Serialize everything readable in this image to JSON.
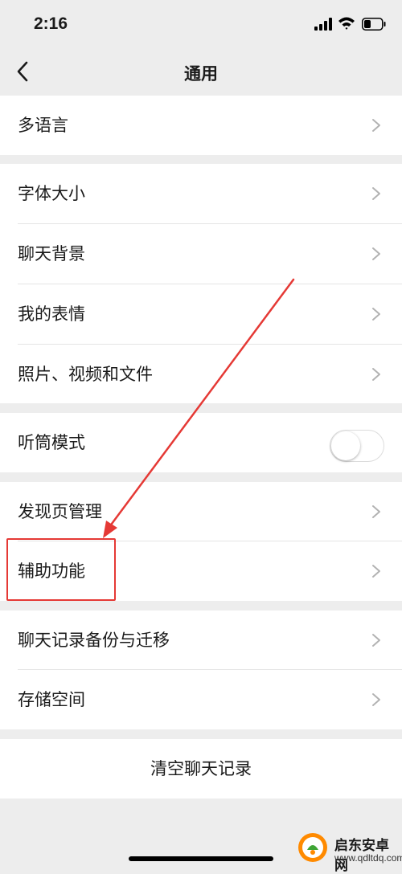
{
  "status_bar": {
    "time": "2:16"
  },
  "nav": {
    "title": "通用"
  },
  "groups": [
    {
      "items": [
        {
          "label": "多语言",
          "type": "chevron"
        }
      ]
    },
    {
      "items": [
        {
          "label": "字体大小",
          "type": "chevron"
        },
        {
          "label": "聊天背景",
          "type": "chevron"
        },
        {
          "label": "我的表情",
          "type": "chevron"
        },
        {
          "label": "照片、视频和文件",
          "type": "chevron"
        }
      ]
    },
    {
      "items": [
        {
          "label": "听筒模式",
          "type": "toggle",
          "on": false
        }
      ]
    },
    {
      "items": [
        {
          "label": "发现页管理",
          "type": "chevron"
        },
        {
          "label": "辅助功能",
          "type": "chevron",
          "highlighted": true
        }
      ]
    },
    {
      "items": [
        {
          "label": "聊天记录备份与迁移",
          "type": "chevron"
        },
        {
          "label": "存储空间",
          "type": "chevron"
        }
      ]
    },
    {
      "items": [
        {
          "label": "清空聊天记录",
          "type": "action"
        }
      ]
    }
  ],
  "annotation": {
    "color": "#e53935"
  },
  "watermark": {
    "name": "启东安卓网",
    "url": "www.qdltdq.com"
  },
  "colors": {
    "background": "#ededed",
    "card": "#ffffff",
    "divider": "#e5e5e5",
    "chevron": "#b2b2b2"
  }
}
